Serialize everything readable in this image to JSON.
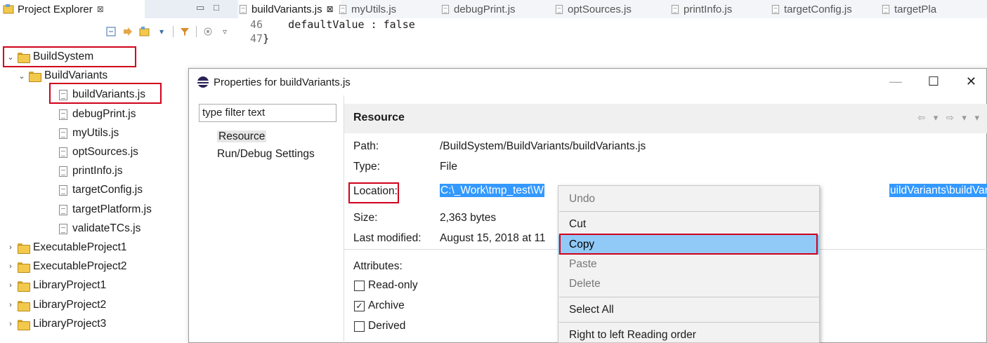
{
  "explorer": {
    "tab_label": "Project Explorer",
    "tab_close": "⊠",
    "minimize": "▭",
    "maximize": "□",
    "tree": [
      {
        "label": "BuildSystem",
        "type": "folder",
        "expanded": true
      },
      {
        "label": "BuildVariants",
        "type": "folder",
        "expanded": true
      },
      {
        "label": "buildVariants.js",
        "type": "file"
      },
      {
        "label": "debugPrint.js",
        "type": "file"
      },
      {
        "label": "myUtils.js",
        "type": "file"
      },
      {
        "label": "optSources.js",
        "type": "file"
      },
      {
        "label": "printInfo.js",
        "type": "file"
      },
      {
        "label": "targetConfig.js",
        "type": "file"
      },
      {
        "label": "targetPlatform.js",
        "type": "file"
      },
      {
        "label": "validateTCs.js",
        "type": "file"
      },
      {
        "label": "ExecutableProject1",
        "type": "folder",
        "expanded": false
      },
      {
        "label": "ExecutableProject2",
        "type": "folder",
        "expanded": false
      },
      {
        "label": "LibraryProject1",
        "type": "folder",
        "expanded": false
      },
      {
        "label": "LibraryProject2",
        "type": "folder",
        "expanded": false
      },
      {
        "label": "LibraryProject3",
        "type": "folder",
        "expanded": false
      }
    ]
  },
  "editor": {
    "tabs": [
      "buildVariants.js",
      "myUtils.js",
      "debugPrint.js",
      "optSources.js",
      "printInfo.js",
      "targetConfig.js",
      "targetPla"
    ],
    "active_tab_close": "⊠",
    "lines": [
      {
        "num": "46",
        "text": "    defaultValue : false"
      },
      {
        "num": "47",
        "text": "}"
      }
    ]
  },
  "dialog": {
    "title": "Properties for buildVariants.js",
    "minimize": "—",
    "maximize": "☐",
    "close": "✕",
    "filter_placeholder": "type filter text",
    "nav": [
      "Resource",
      "Run/Debug Settings"
    ],
    "section_title": "Resource",
    "props": {
      "path_label": "Path:",
      "path_value": "/BuildSystem/BuildVariants/buildVariants.js",
      "type_label": "Type:",
      "type_value": "File",
      "location_label": "Location:",
      "location_value_start": "C:\\_Work\\tmp_test\\W",
      "location_value_end": "uildVariants\\buildVariants.js",
      "size_label": "Size:",
      "size_value": "2,363  bytes",
      "modified_label": "Last modified:",
      "modified_value": "August 15, 2018 at 11"
    },
    "attributes_label": "Attributes:",
    "checkboxes": [
      {
        "label": "Read-only",
        "checked": false
      },
      {
        "label": "Archive",
        "checked": true
      },
      {
        "label": "Derived",
        "checked": false
      }
    ]
  },
  "context_menu": {
    "items": [
      "Undo",
      "Cut",
      "Copy",
      "Paste",
      "Delete",
      "Select All",
      "Right to left Reading order"
    ],
    "highlighted": "Copy",
    "disabled": [
      "Undo",
      "Paste",
      "Delete"
    ]
  },
  "colors": {
    "highlight_box": "#d0021b",
    "selection": "#3399ff",
    "menu_hover": "#91c9f7"
  }
}
